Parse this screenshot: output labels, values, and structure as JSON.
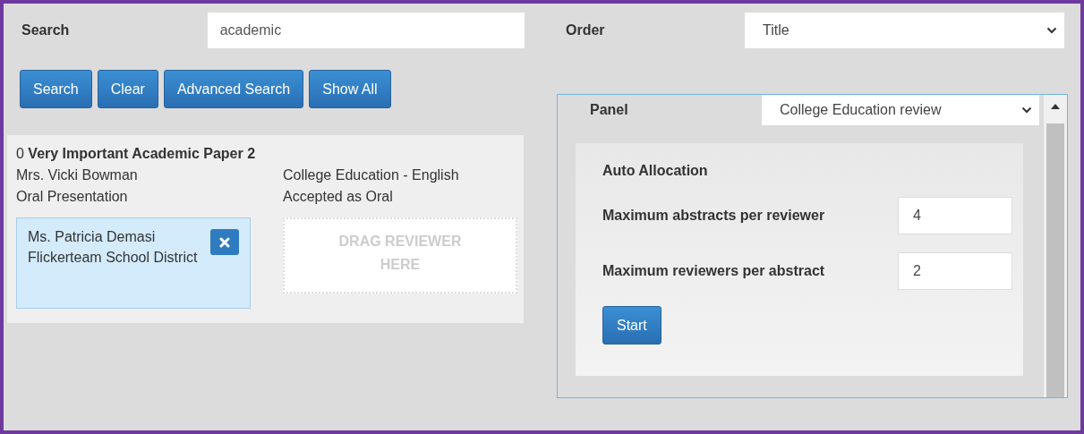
{
  "search": {
    "label": "Search",
    "value": "academic"
  },
  "order": {
    "label": "Order",
    "value": "Title"
  },
  "buttons": [
    "Search",
    "Clear",
    "Advanced Search",
    "Show All"
  ],
  "paper": {
    "number": "0",
    "title": "Very Important Academic Paper 2",
    "author": "Mrs. Vicki Bowman",
    "category": "College Education - English",
    "type": "Oral Presentation",
    "status": "Accepted as Oral",
    "reviewers": [
      {
        "name": "Ms. Patricia Demasi",
        "organisation": "Flickerteam School District"
      }
    ],
    "drop_zone": "DRAG REVIEWER HERE"
  },
  "panel": {
    "label": "Panel",
    "value": "College Education review",
    "auto_allocation": {
      "title": "Auto Allocation",
      "fields": [
        {
          "label": "Maximum abstracts per reviewer",
          "value": "4"
        },
        {
          "label": "Maximum reviewers per abstract",
          "value": "2"
        }
      ],
      "button": "Start"
    }
  }
}
